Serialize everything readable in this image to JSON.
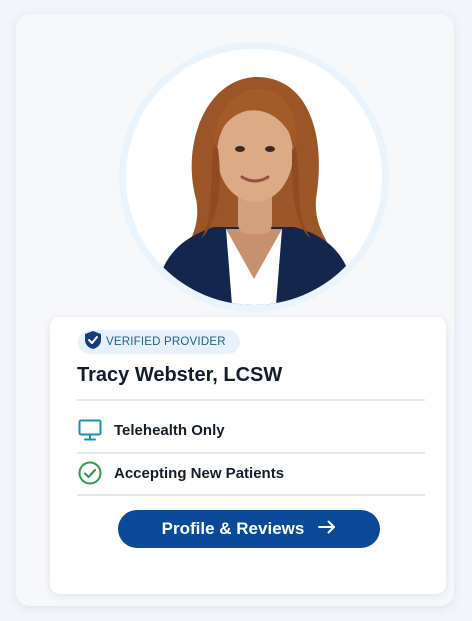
{
  "provider": {
    "badge_label": "VERIFIED PROVIDER",
    "name": "Tracy Webster, LCSW",
    "features": [
      {
        "label": "Telehealth Only",
        "icon": "monitor-icon"
      },
      {
        "label": "Accepting New Patients",
        "icon": "check-circle-icon"
      }
    ],
    "cta_label": "Profile & Reviews",
    "cta_icon": "arrow-right-icon",
    "badge_icon": "shield-check-icon"
  },
  "colors": {
    "primary": "#0b4a98",
    "badge_bg": "#e6f1fb",
    "check_green": "#2e9a4c",
    "monitor_teal": "#1d8fb5"
  }
}
